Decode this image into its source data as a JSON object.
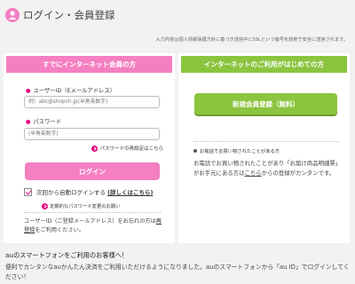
{
  "header": {
    "title": "ログイン・会員登録"
  },
  "notice": "入力内容は個人情報保護方針に基づき送信中にSSLという暗号化技術で安全に送信されます。",
  "login": {
    "heading": "すでにインターネット会員の方",
    "user_id_label": "ユーザーID（Eメールアドレス）",
    "user_id_placeholder": "例）abc@shopch.jp(半角英数字)",
    "password_label": "パスワード",
    "password_placeholder": "(半角英数字)",
    "forgot_password": "パスワードの再設定はこちら",
    "login_button": "ログイン",
    "auto_login_label": "次回から自動ログインする",
    "auto_login_detail": "(詳しくはこちら)",
    "auto_login_change": "定期的なパスワード変更のお願い",
    "help_before": "ユーザーID（ご登録メールアドレス）をお忘れの方は",
    "help_link": "再登録",
    "help_after": "をご利用ください。"
  },
  "register": {
    "heading": "インターネットのご利用がはじめての方",
    "button": "新規会員登録（無料）",
    "purchase_title": "お電話でお買い物されたことがある方",
    "purchase_before": "お電話でお買い物されたことがあり「お届け商品明細票」がお手元にある方は",
    "purchase_link": "こちら",
    "purchase_after": "からの登録がカンタンです。"
  },
  "au": {
    "title": "auのスマートフォンをご利用のお客様へ！",
    "text": "便利でカンタンなauかんたん決済をご利用いただけるようになりました。auのスマートフォンから「au ID」でログインしてください！"
  },
  "colors": {
    "pink": "#f47fc1",
    "green": "#8bc53f",
    "magenta": "#e6007e"
  }
}
